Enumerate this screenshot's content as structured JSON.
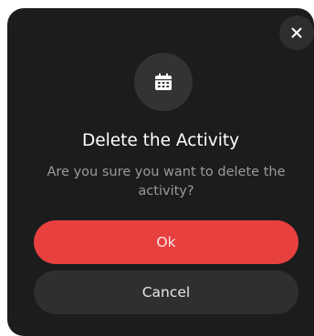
{
  "dialog": {
    "title": "Delete the Activity",
    "message": "Are you sure you want to delete the activity?",
    "icon": "calendar-icon",
    "close_icon": "close-icon",
    "ok_label": "Ok",
    "cancel_label": "Cancel"
  },
  "colors": {
    "dialog_background": "#1c1c1c",
    "icon_background": "#333333",
    "ok_button": "#e8403f",
    "cancel_button": "#2f2f2f",
    "message_text": "#9a9a9a"
  }
}
